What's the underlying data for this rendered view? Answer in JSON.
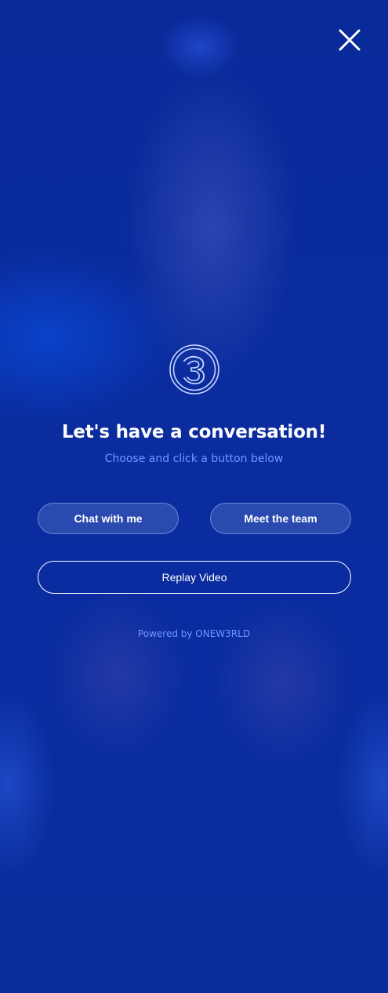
{
  "header": {
    "close_icon": "close-icon"
  },
  "brand": {
    "logo_icon": "onew3rld-logo-icon",
    "accent_color": "#6f97ff",
    "background_color": "#0a2a9e"
  },
  "main": {
    "title": "Let's have a conversation!",
    "subtitle": "Choose and click a button below",
    "buttons": {
      "chat_label": "Chat with me",
      "team_label": "Meet the team",
      "replay_label": "Replay Video"
    }
  },
  "footer": {
    "powered_by": "Powered by ONEW3RLD"
  }
}
